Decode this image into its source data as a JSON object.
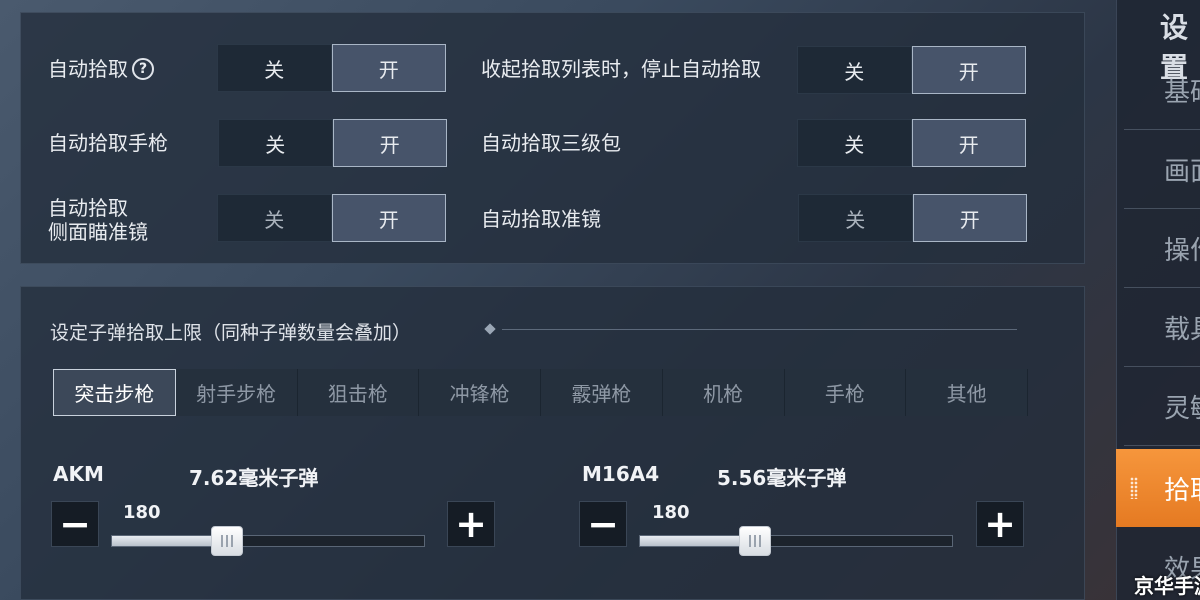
{
  "toggle_labels": {
    "off": "关",
    "on": "开"
  },
  "top_settings": {
    "auto_pickup": {
      "label": "自动拾取",
      "help_icon": "?",
      "state": "开"
    },
    "auto_pickup_pistol": {
      "label": "自动拾取手枪",
      "state": "开"
    },
    "auto_pickup_side_scope": {
      "label_line1": "自动拾取",
      "label_line2": "侧面瞄准镜",
      "state": "开"
    },
    "stop_on_collapse": {
      "label": "收起拾取列表时，停止自动拾取",
      "state": "开"
    },
    "auto_pickup_lv3_bag": {
      "label": "自动拾取三级包",
      "state": "开"
    },
    "auto_pickup_scope": {
      "label": "自动拾取准镜",
      "state": "开"
    }
  },
  "ammo_section": {
    "title": "设定子弹拾取上限（同种子弹数量会叠加）",
    "tabs": [
      "突击步枪",
      "射手步枪",
      "狙击枪",
      "冲锋枪",
      "霰弹枪",
      "机枪",
      "手枪",
      "其他"
    ],
    "active_tab": "突击步枪",
    "guns": [
      {
        "name": "AKM",
        "ammo": "7.62毫米子弹",
        "value": "180",
        "fraction": 0.37,
        "minus": "−",
        "plus": "+"
      },
      {
        "name": "M16A4",
        "ammo": "5.56毫米子弹",
        "value": "180",
        "fraction": 0.37,
        "minus": "−",
        "plus": "+"
      }
    ]
  },
  "sidebar": {
    "header": "设置",
    "items": [
      "基础",
      "画面",
      "操作",
      "载具",
      "灵敏",
      "拾取",
      "效果"
    ],
    "active_item": "拾取"
  },
  "watermark": "京华手游"
}
